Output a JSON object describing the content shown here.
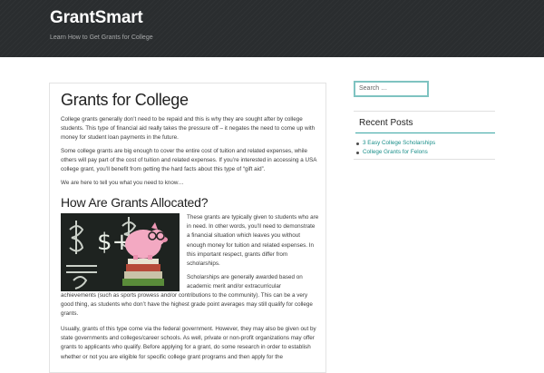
{
  "site": {
    "title": "GrantSmart",
    "description": "Learn How to Get Grants for College"
  },
  "article": {
    "title": "Grants for College",
    "intro": [
      "College grants generally don’t need to be repaid and this is why they are sought after by college students. This type of financial aid really takes the pressure off – it negates the need to come up with money for student loan payments in the future.",
      "Some college grants are big enough to cover the entire cost of tuition and related expenses, while others will pay part of the cost of tuition and related expenses. If you’re interested in accessing a USA college grant, you’ll benefit from getting the hard facts about this type of “gift aid”.",
      "We are here to tell you what you need to know…"
    ],
    "section_heading": "How Are Grants Allocated?",
    "image_icon": "piggy-bank-chalkboard-image",
    "image_text": "$+$",
    "side_paragraphs": [
      "These grants are typically given to students who are in need. In other words, you’ll need to demonstrate a financial situation which leaves you without enough money for tuition and related expenses. In this important respect, grants differ from scholarships.",
      "Scholarships are generally awarded based on academic merit and/or extracurricular"
    ],
    "continued_paragraph": "achievements (such as sports prowess and/or contributions to the community). This can be a very good thing, as students who don’t have the highest grade point averages may still qualify for college grants.",
    "last_paragraph": "Usually, grants of this type come via the federal government. However, they may also be given out by state governments and colleges/career schools. As well, private or non-profit organizations may offer grants to applicants who qualify. Before applying for a grant, do some research in order to establish whether or not you are eligible for specific college grant programs and then apply for the"
  },
  "sidebar": {
    "search_placeholder": "Search …",
    "recent_posts_title": "Recent Posts",
    "recent_posts": [
      "3 Easy College Scholarships",
      "College Grants for Felons"
    ]
  },
  "colors": {
    "header_bg": "#2a2d2f",
    "accent": "#3aa7a4",
    "link": "#1a8f8a"
  }
}
